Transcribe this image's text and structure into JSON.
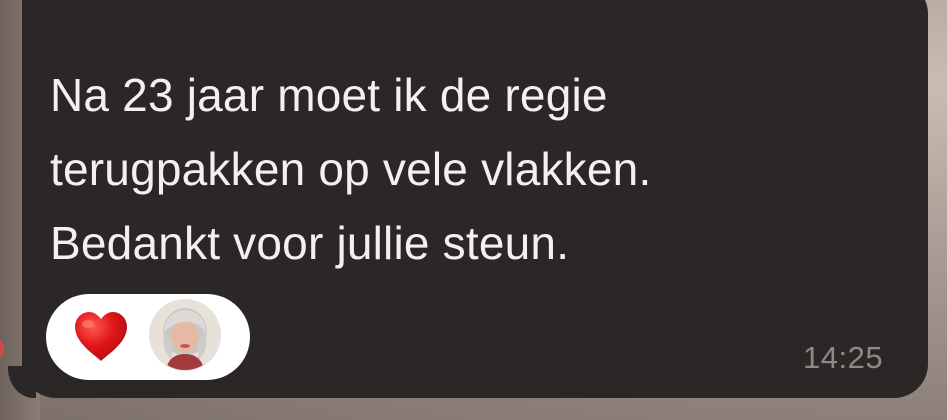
{
  "message": {
    "line1": "Na 23 jaar moet ik de regie",
    "line2": "terugpakken op vele vlakken.",
    "line3": "Bedankt voor jullie steun.",
    "time": "14:25"
  },
  "reactions": {
    "items": [
      {
        "icon": "heart-icon",
        "color": "#e0171b"
      },
      {
        "icon": "avatar"
      }
    ],
    "pill_color": "#ffffff"
  },
  "colors": {
    "bubble": "#2a2726",
    "text": "#f3f1ef",
    "timestamp": "#8e8986"
  }
}
